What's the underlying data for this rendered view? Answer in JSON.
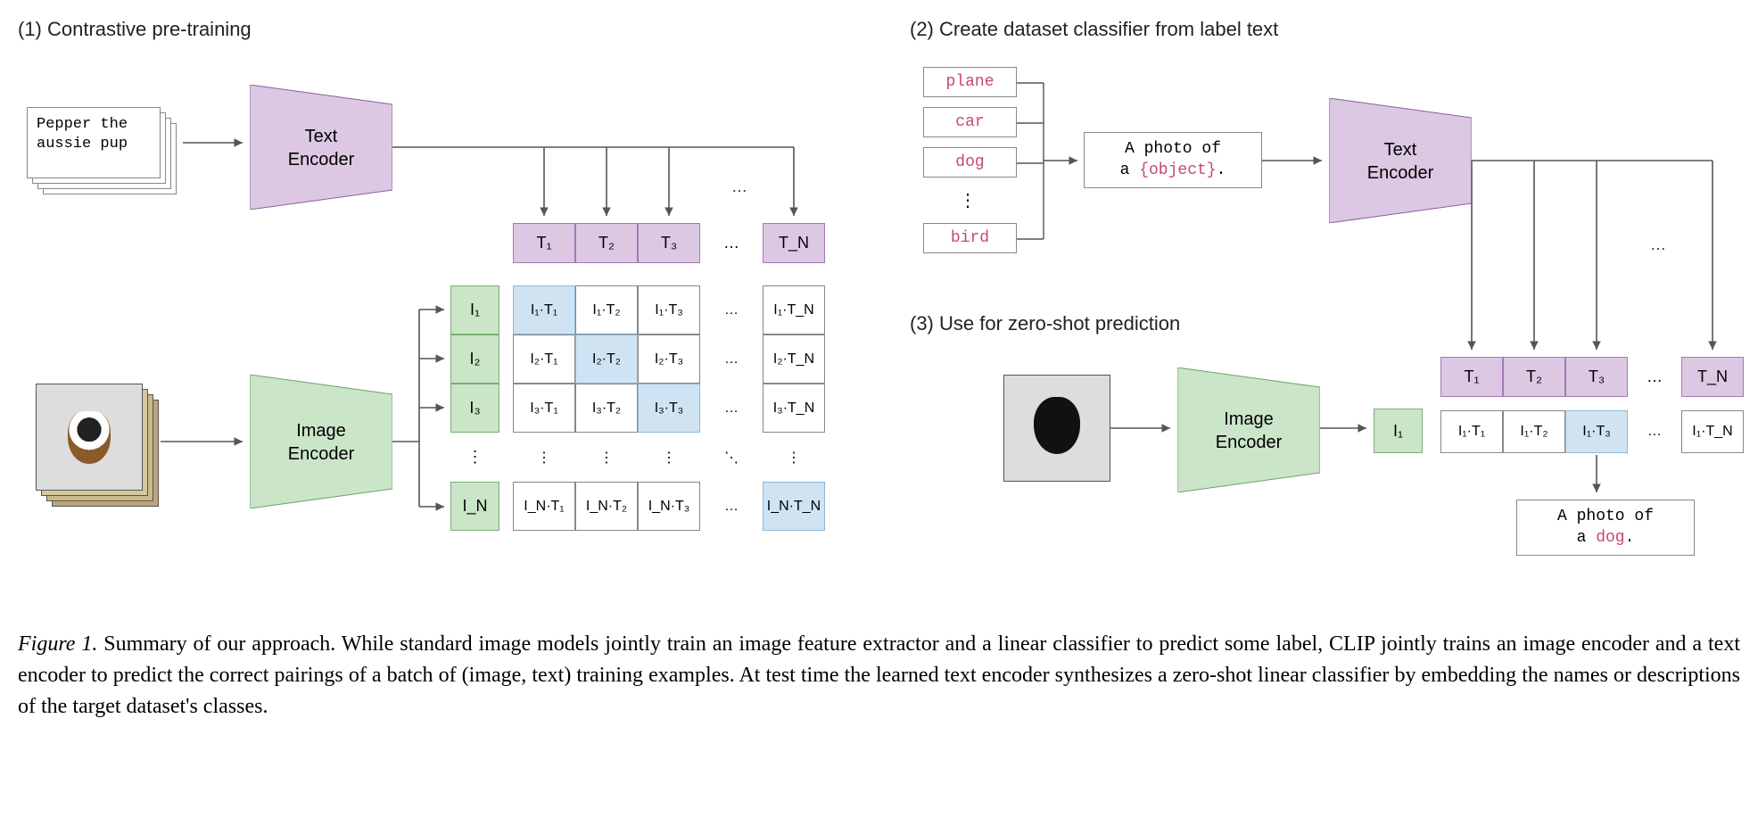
{
  "sections": {
    "s1": "(1) Contrastive pre-training",
    "s2": "(2) Create dataset classifier from label text",
    "s3": "(3) Use for zero-shot prediction"
  },
  "text_input": "Pepper the\naussie pup",
  "encoders": {
    "text": "Text\nEncoder",
    "image": "Image\nEncoder"
  },
  "t_row": [
    "T₁",
    "T₂",
    "T₃",
    "…",
    "T_N"
  ],
  "i_col": [
    "I₁",
    "I₂",
    "I₃",
    "⋮",
    "I_N"
  ],
  "matrix": [
    [
      "I₁·T₁",
      "I₁·T₂",
      "I₁·T₃",
      "…",
      "I₁·T_N"
    ],
    [
      "I₂·T₁",
      "I₂·T₂",
      "I₂·T₃",
      "…",
      "I₂·T_N"
    ],
    [
      "I₃·T₁",
      "I₃·T₂",
      "I₃·T₃",
      "…",
      "I₃·T_N"
    ],
    [
      "⋮",
      "⋮",
      "⋮",
      "⋱",
      "⋮"
    ],
    [
      "I_N·T₁",
      "I_N·T₂",
      "I_N·T₃",
      "…",
      "I_N·T_N"
    ]
  ],
  "class_labels": [
    "plane",
    "car",
    "dog",
    "⋮",
    "bird"
  ],
  "prompt_template": {
    "pre": "A photo of\na ",
    "obj": "{object}",
    "post": "."
  },
  "t_row2": [
    "T₁",
    "T₂",
    "T₃",
    "…",
    "T_N"
  ],
  "i1_label": "I₁",
  "pred_row": [
    "I₁·T₁",
    "I₁·T₂",
    "I₁·T₃",
    "…",
    "I₁·T_N"
  ],
  "pred_highlight_index": 2,
  "pred_output": {
    "pre": "A photo of\na ",
    "cls": "dog",
    "post": "."
  },
  "caption": {
    "figno": "Figure 1.",
    "text": " Summary of our approach. While standard image models jointly train an image feature extractor and a linear classifier to predict some label, CLIP jointly trains an image encoder and a text encoder to predict the correct pairings of a batch of (image, text) training examples. At test time the learned text encoder synthesizes a zero-shot linear classifier by embedding the names or descriptions of the target dataset's classes."
  },
  "colors": {
    "purple": "#dcc8e2",
    "green": "#cbe5c8",
    "blue": "#cfe3f2"
  }
}
